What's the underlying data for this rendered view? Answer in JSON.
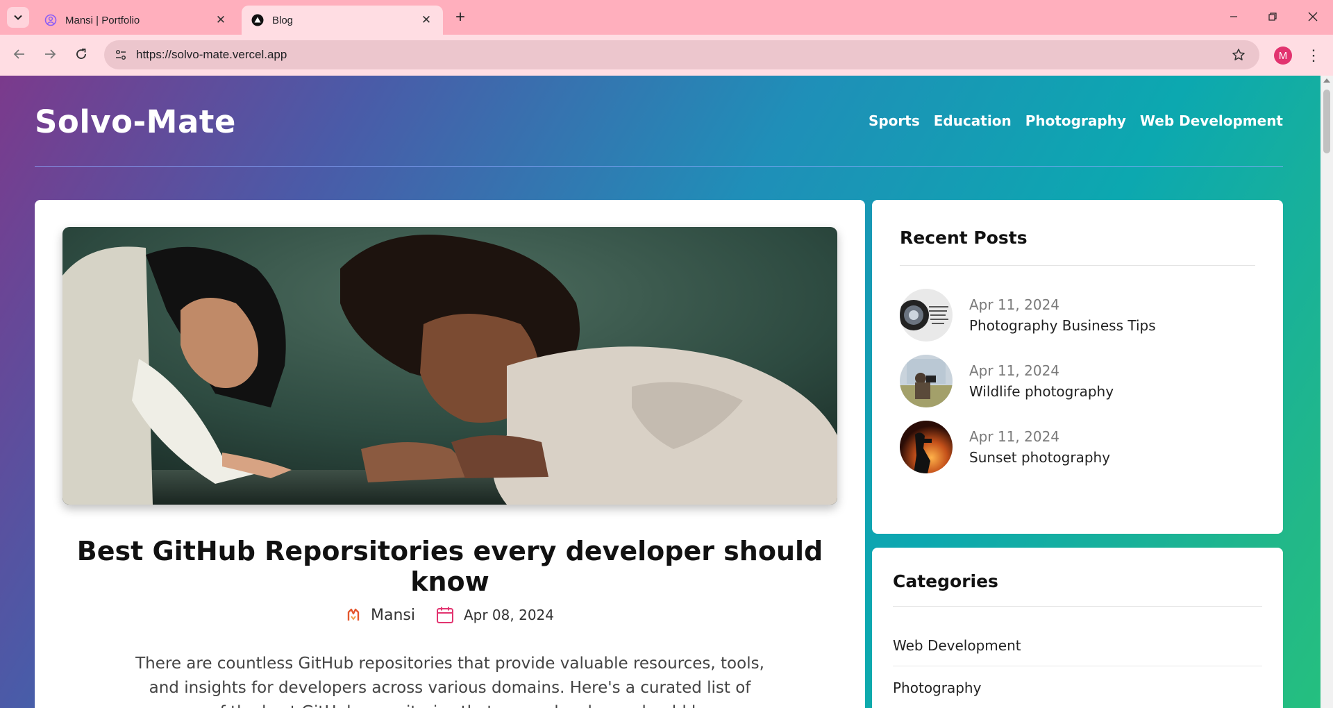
{
  "browser": {
    "tabs": [
      {
        "title": "Mansi | Portfolio",
        "icon": "portfolio-favicon",
        "active": false
      },
      {
        "title": "Blog",
        "icon": "vercel-favicon",
        "active": true
      }
    ],
    "url": "https://solvo-mate.vercel.app",
    "profile_initial": "M",
    "accent": "#ffafbd"
  },
  "site": {
    "brand": "Solvo-Mate",
    "nav": [
      "Sports",
      "Education",
      "Photography",
      "Web Development"
    ]
  },
  "post": {
    "title": "Best GitHub Reporsitories every developer should know",
    "author": "Mansi",
    "date": "Apr 08, 2024",
    "excerpt": "There are countless GitHub repositories that provide valuable resources, tools, and insights for developers across various domains. Here's a curated list of some of the best GitHub repositories that every developer should know:"
  },
  "recent": {
    "heading": "Recent Posts",
    "items": [
      {
        "date": "Apr 11, 2024",
        "title": "Photography Business Tips"
      },
      {
        "date": "Apr 11, 2024",
        "title": "Wildlife photography"
      },
      {
        "date": "Apr 11, 2024",
        "title": "Sunset photography"
      }
    ]
  },
  "categories": {
    "heading": "Categories",
    "items": [
      "Web Development",
      "Photography"
    ]
  }
}
